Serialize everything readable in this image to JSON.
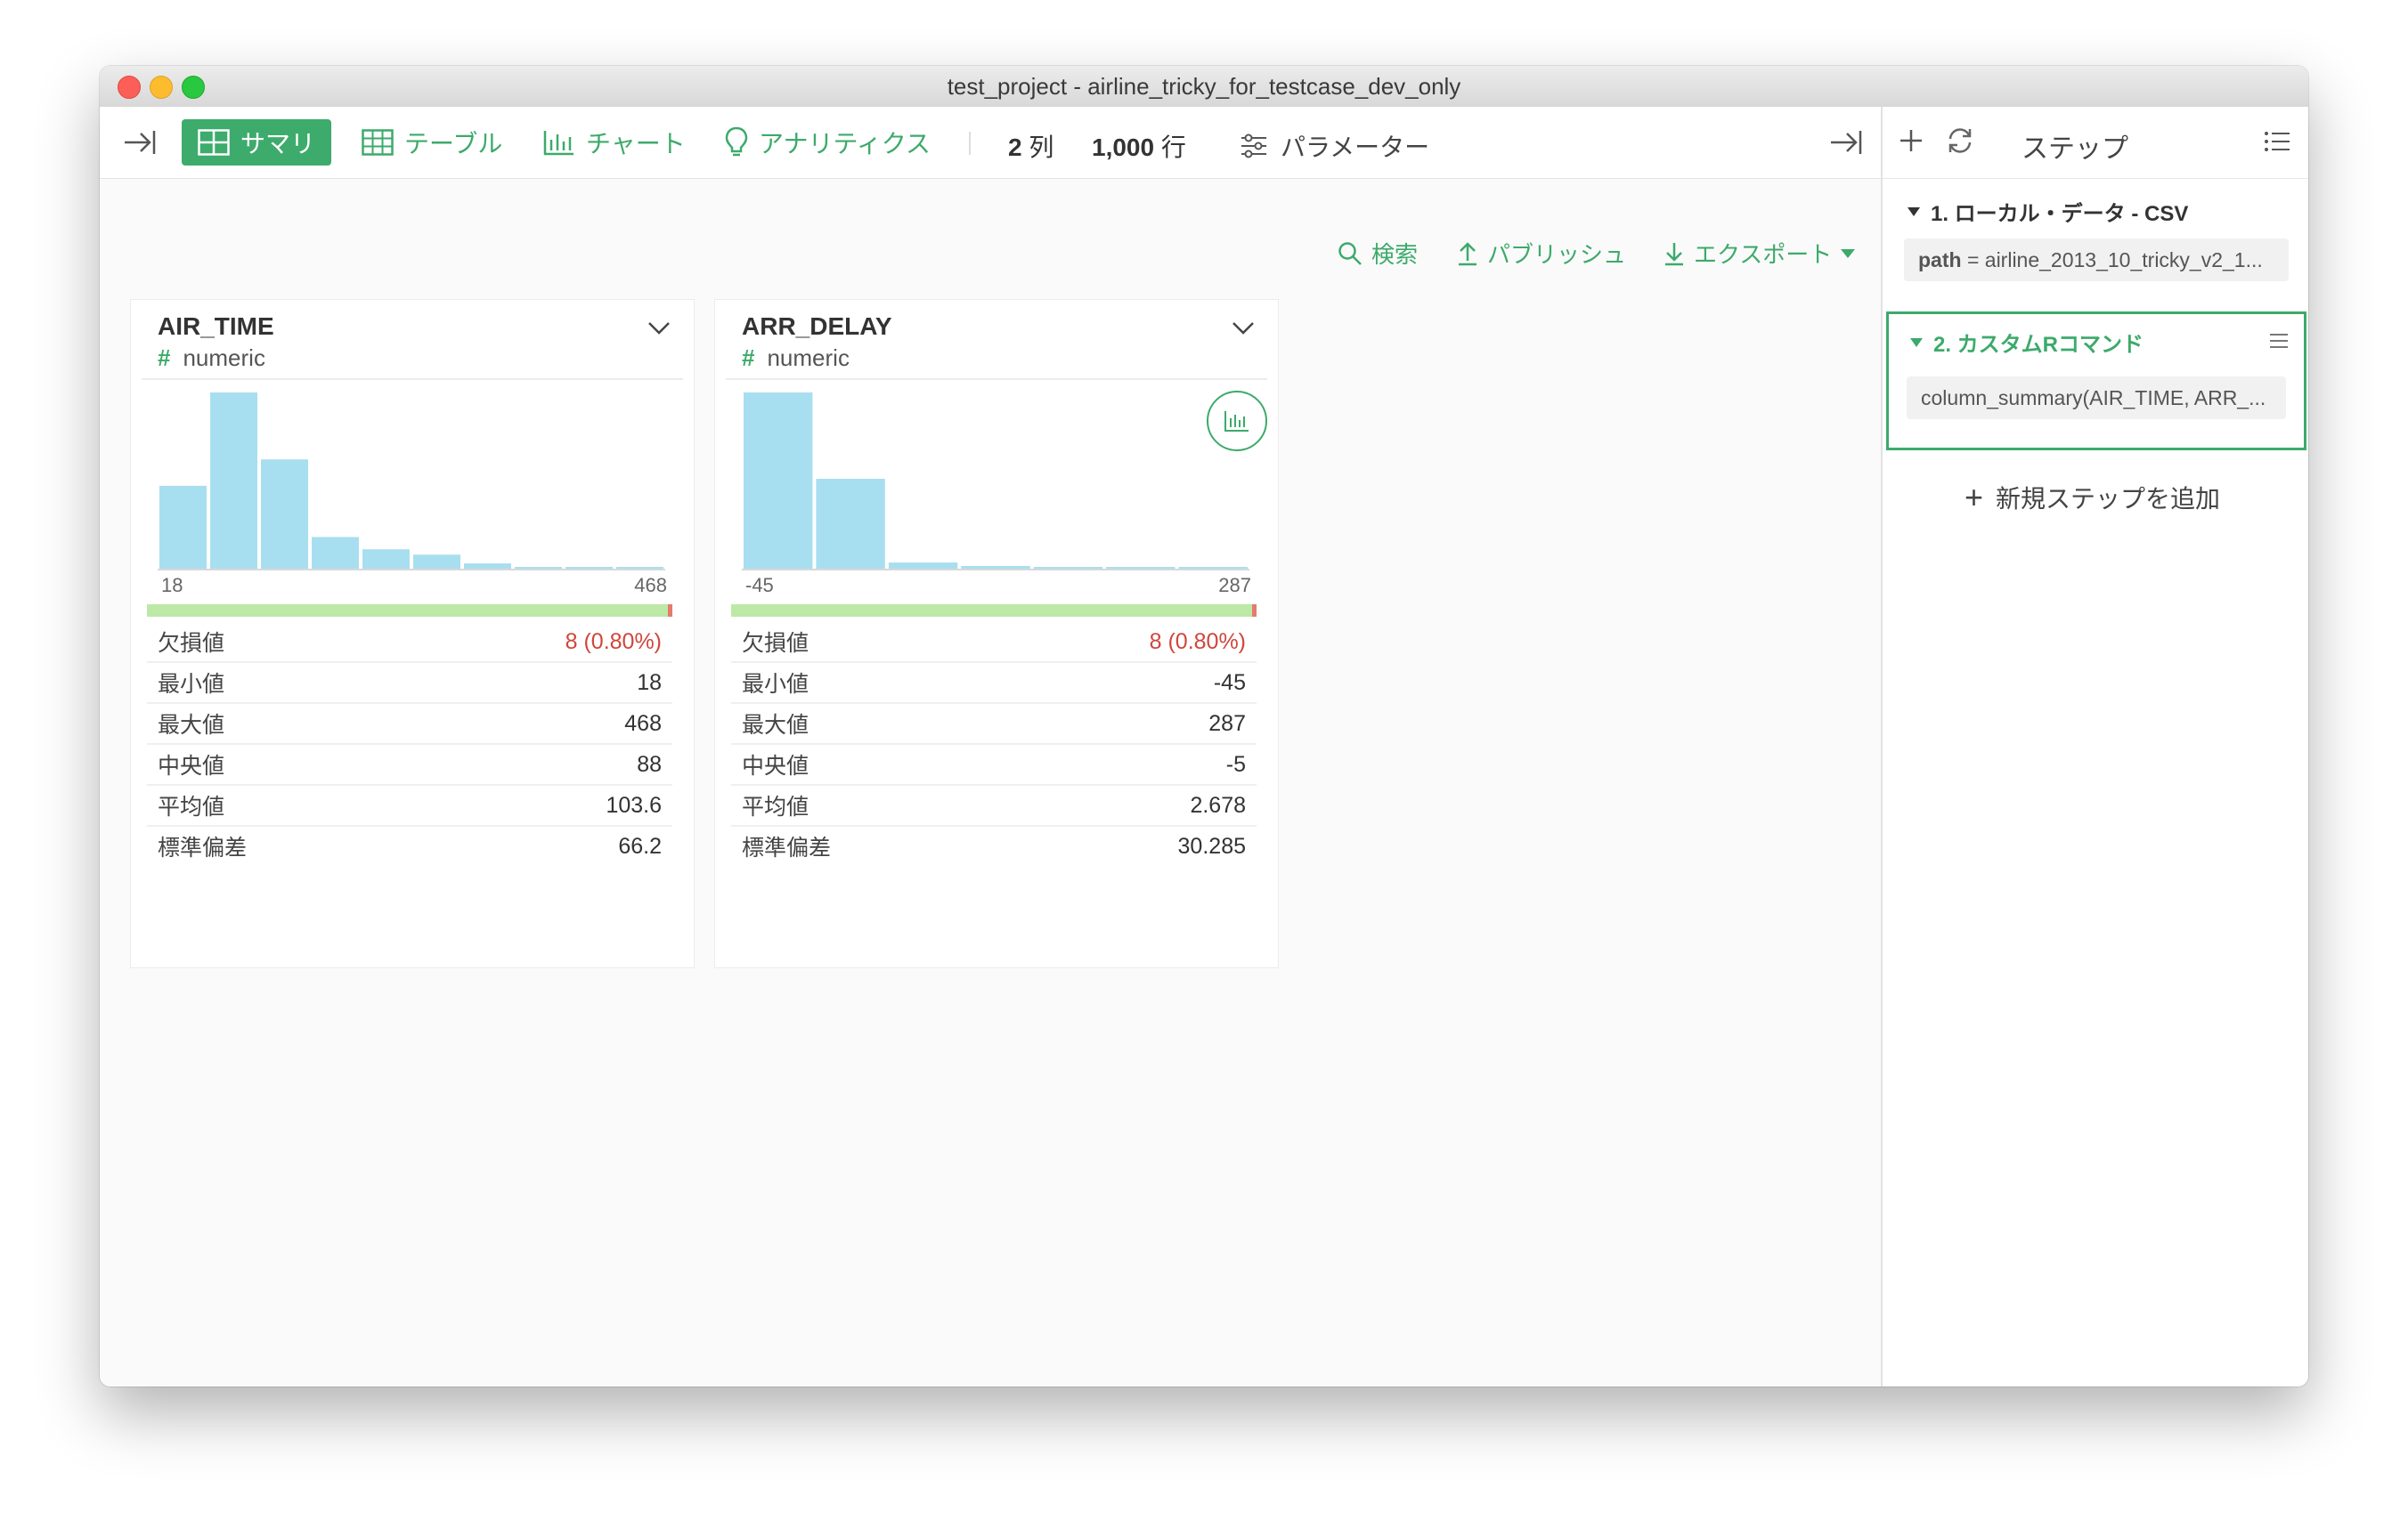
{
  "window": {
    "title": "test_project - airline_tricky_for_testcase_dev_only"
  },
  "toolbar": {
    "tabs": [
      {
        "label": "サマリ",
        "icon": "grid-icon",
        "active": true
      },
      {
        "label": "テーブル",
        "icon": "table-icon",
        "active": false
      },
      {
        "label": "チャート",
        "icon": "bar-chart-icon",
        "active": false
      },
      {
        "label": "アナリティクス",
        "icon": "lightbulb-icon",
        "active": false
      }
    ],
    "col_count": "2",
    "col_unit": "列",
    "row_count": "1,000",
    "row_unit": "行",
    "params_label": "パラメーター"
  },
  "actions": {
    "search": "検索",
    "publish": "パブリッシュ",
    "export": "エクスポート"
  },
  "columns": [
    {
      "name": "AIR_TIME",
      "type": "numeric",
      "hist_min": "18",
      "hist_max": "468",
      "hist_counts": [
        0.47,
        1.0,
        0.62,
        0.18,
        0.11,
        0.08,
        0.03,
        0.01,
        0.005,
        0.005
      ],
      "missing_ratio": 0.008,
      "stats": [
        {
          "label": "欠損値",
          "value": "8 (0.80%)",
          "highlight": true
        },
        {
          "label": "最小値",
          "value": "18"
        },
        {
          "label": "最大値",
          "value": "468"
        },
        {
          "label": "中央値",
          "value": "88"
        },
        {
          "label": "平均値",
          "value": "103.6"
        },
        {
          "label": "標準偏差",
          "value": "66.2"
        }
      ]
    },
    {
      "name": "ARR_DELAY",
      "type": "numeric",
      "hist_min": "-45",
      "hist_max": "287",
      "hist_counts": [
        1.0,
        0.51,
        0.035,
        0.015,
        0.01,
        0.005,
        0.005
      ],
      "missing_ratio": 0.008,
      "stats": [
        {
          "label": "欠損値",
          "value": "8 (0.80%)",
          "highlight": true
        },
        {
          "label": "最小値",
          "value": "-45"
        },
        {
          "label": "最大値",
          "value": "287"
        },
        {
          "label": "中央値",
          "value": "-5"
        },
        {
          "label": "平均値",
          "value": "2.678"
        },
        {
          "label": "標準偏差",
          "value": "30.285"
        }
      ]
    }
  ],
  "sidebar": {
    "title": "ステップ",
    "steps": [
      {
        "title": "1. ローカル・データ - CSV",
        "param_key": "path",
        "param_eq": " = ",
        "param_value": "airline_2013_10_tricky_v2_1..."
      },
      {
        "title": "2. カスタムRコマンド",
        "body": "column_summary(AIR_TIME, ARR_..."
      }
    ],
    "add_step": "新規ステップを追加"
  },
  "colors": {
    "accent": "#3dab6c",
    "hist_bar": "#a8dff0",
    "valid": "#bce9a6",
    "missing": "#e57b6d",
    "missing_text": "#d0463b"
  }
}
